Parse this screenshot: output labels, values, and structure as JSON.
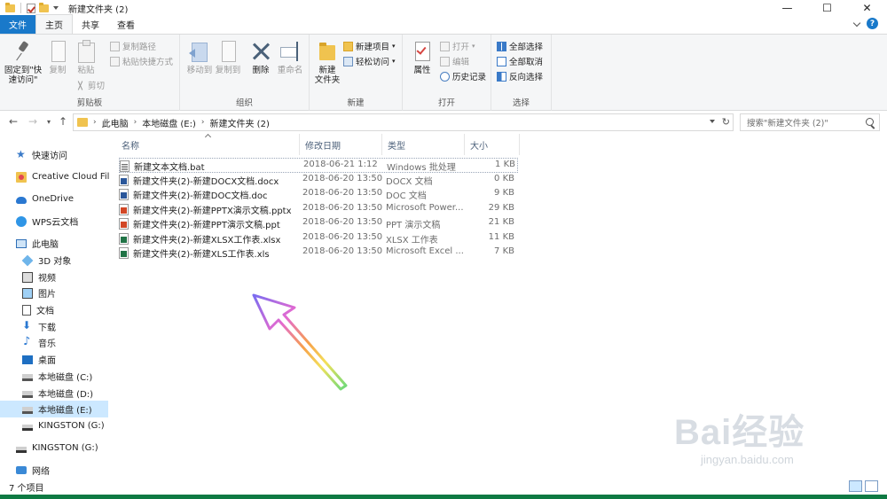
{
  "window": {
    "title": "新建文件夹 (2)",
    "controls": {
      "minimize": "—",
      "maximize": "☐",
      "close": "✕"
    }
  },
  "ribbon_tabs": [
    {
      "label": "文件"
    },
    {
      "label": "主页"
    },
    {
      "label": "共享"
    },
    {
      "label": "查看"
    }
  ],
  "ribbon": {
    "clipboard": {
      "label": "剪贴板",
      "pin": "固定到\"快\n速访问\"",
      "copy": "复制",
      "paste": "粘贴",
      "copy_path": "复制路径",
      "paste_shortcut": "粘贴快捷方式",
      "cut": "剪切"
    },
    "organize": {
      "label": "组织",
      "move_to": "移动到",
      "copy_to": "复制到",
      "delete": "删除",
      "rename": "重命名"
    },
    "new": {
      "label": "新建",
      "new_folder": "新建\n文件夹",
      "new_item": "新建项目",
      "easy_access": "轻松访问"
    },
    "open": {
      "label": "打开",
      "properties": "属性",
      "open": "打开",
      "edit": "编辑",
      "history": "历史记录"
    },
    "select": {
      "label": "选择",
      "select_all": "全部选择",
      "select_none": "全部取消",
      "invert": "反向选择"
    }
  },
  "address": {
    "crumbs": [
      "此电脑",
      "本地磁盘 (E:)",
      "新建文件夹 (2)"
    ],
    "search_placeholder": "搜索\"新建文件夹 (2)\""
  },
  "sidebar": [
    {
      "label": "快速访问",
      "icon": "star-icon"
    },
    {
      "label": "Creative Cloud Files",
      "icon": "creative-cloud-icon"
    },
    {
      "label": "OneDrive",
      "icon": "onedrive-icon"
    },
    {
      "label": "WPS云文档",
      "icon": "wps-cloud-icon"
    },
    {
      "label": "此电脑",
      "icon": "this-pc-icon"
    },
    {
      "label": "3D 对象",
      "icon": "3d-objects-icon"
    },
    {
      "label": "视频",
      "icon": "video-icon"
    },
    {
      "label": "图片",
      "icon": "pictures-icon"
    },
    {
      "label": "文档",
      "icon": "documents-icon"
    },
    {
      "label": "下载",
      "icon": "downloads-icon"
    },
    {
      "label": "音乐",
      "icon": "music-icon"
    },
    {
      "label": "桌面",
      "icon": "desktop-icon"
    },
    {
      "label": "本地磁盘 (C:)",
      "icon": "drive-icon"
    },
    {
      "label": "本地磁盘 (D:)",
      "icon": "drive-icon"
    },
    {
      "label": "本地磁盘 (E:)",
      "icon": "drive-icon",
      "selected": true
    },
    {
      "label": "KINGSTON (G:)",
      "icon": "usb-drive-icon"
    },
    {
      "label": "KINGSTON (G:)",
      "icon": "usb-drive-icon"
    },
    {
      "label": "网络",
      "icon": "network-icon"
    }
  ],
  "columns": {
    "name": "名称",
    "date": "修改日期",
    "type": "类型",
    "size": "大小"
  },
  "files": [
    {
      "name": "新建文本文档.bat",
      "date": "2018-06-21 1:12",
      "type": "Windows 批处理",
      "size": "1 KB",
      "icon": "bat"
    },
    {
      "name": "新建文件夹(2)-新建DOCX文档.docx",
      "date": "2018-06-20 13:50",
      "type": "DOCX 文档",
      "size": "0 KB",
      "icon": "word"
    },
    {
      "name": "新建文件夹(2)-新建DOC文档.doc",
      "date": "2018-06-20 13:50",
      "type": "DOC 文档",
      "size": "9 KB",
      "icon": "word"
    },
    {
      "name": "新建文件夹(2)-新建PPTX演示文稿.pptx",
      "date": "2018-06-20 13:50",
      "type": "Microsoft Power...",
      "size": "29 KB",
      "icon": "ppt"
    },
    {
      "name": "新建文件夹(2)-新建PPT演示文稿.ppt",
      "date": "2018-06-20 13:50",
      "type": "PPT 演示文稿",
      "size": "21 KB",
      "icon": "ppt"
    },
    {
      "name": "新建文件夹(2)-新建XLSX工作表.xlsx",
      "date": "2018-06-20 13:50",
      "type": "XLSX 工作表",
      "size": "11 KB",
      "icon": "xls"
    },
    {
      "name": "新建文件夹(2)-新建XLS工作表.xls",
      "date": "2018-06-20 13:50",
      "type": "Microsoft Excel ...",
      "size": "7 KB",
      "icon": "xls"
    }
  ],
  "status": {
    "count": "7 个项目"
  },
  "watermark": {
    "logo": "Bai经验",
    "url": "jingyan.baidu.com"
  }
}
